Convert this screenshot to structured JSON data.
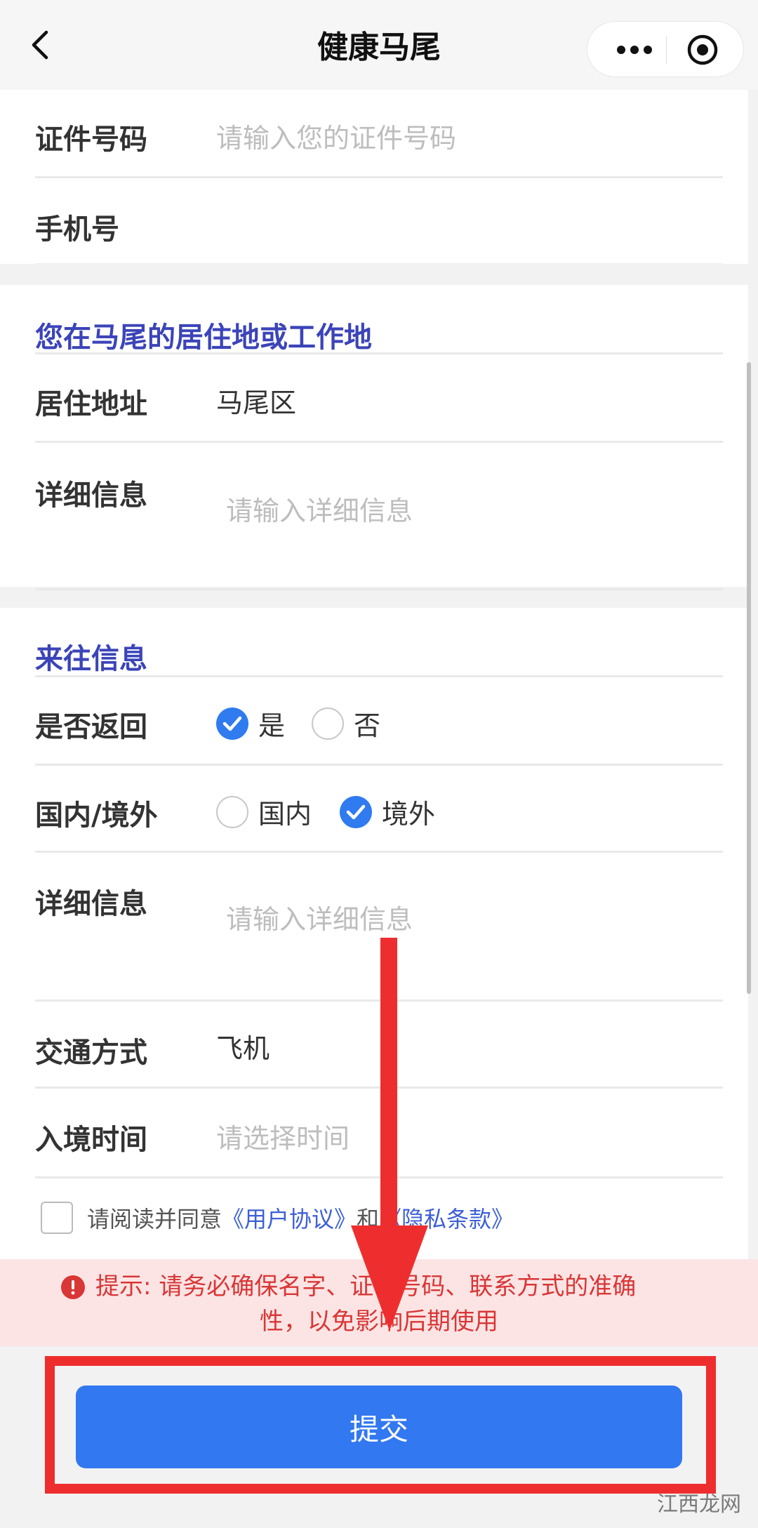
{
  "nav": {
    "title": "健康马尾"
  },
  "section1": {
    "id_label": "证件号码",
    "id_placeholder": "请输入您的证件号码",
    "phone_label": "手机号"
  },
  "section2": {
    "title": "您在马尾的居住地或工作地",
    "address_label": "居住地址",
    "address_value": "马尾区",
    "detail_label": "详细信息",
    "detail_placeholder": "请输入详细信息"
  },
  "section3": {
    "title": "来往信息",
    "return_label": "是否返回",
    "return_options": [
      {
        "label": "是",
        "checked": true
      },
      {
        "label": "否",
        "checked": false
      }
    ],
    "region_label": "国内/境外",
    "region_options": [
      {
        "label": "国内",
        "checked": false
      },
      {
        "label": "境外",
        "checked": true
      }
    ],
    "detail_label": "详细信息",
    "detail_placeholder": "请输入详细信息",
    "transport_label": "交通方式",
    "transport_value": "飞机",
    "entry_label": "入境时间",
    "entry_placeholder": "请选择时间"
  },
  "agreement": {
    "prefix": "请阅读并同意",
    "user_agreement": "《用户协议》",
    "and": "和",
    "privacy": "《隐私条款》"
  },
  "warning": {
    "line1": "提示: 请务必确保名字、证件号码、联系方式的准确",
    "line2": "性，以免影响后期使用"
  },
  "submit_label": "提交",
  "watermark": "江西龙网",
  "colors": {
    "accent": "#3278f0",
    "section_title": "#3b44b8",
    "warning_text": "#d93636",
    "warning_bg": "#fde4e4",
    "annotation_red": "#ee2e2e"
  }
}
